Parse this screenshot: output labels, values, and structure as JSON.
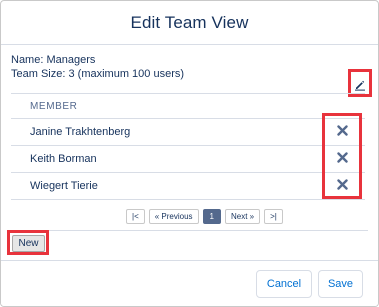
{
  "modal": {
    "title": "Edit Team View"
  },
  "team": {
    "name_label": "Name:",
    "name_value": "Managers",
    "size_label": "Team Size:",
    "size_value": "3 (maximum 100 users)"
  },
  "table": {
    "header": "MEMBER",
    "rows": [
      {
        "name": "Janine Trakhtenberg"
      },
      {
        "name": "Keith Borman"
      },
      {
        "name": "Wiegert Tierie"
      }
    ]
  },
  "pager": {
    "first": "|<",
    "prev": "« Previous",
    "current": "1",
    "next": "Next »",
    "last": ">|"
  },
  "actions": {
    "new_label": "New",
    "cancel_label": "Cancel",
    "save_label": "Save"
  },
  "colors": {
    "highlight": "#e8333c",
    "link": "#0070d2",
    "text": "#16325c",
    "pager_active": "#54698d"
  },
  "icons": {
    "edit": "pencil-icon",
    "remove": "close-x-icon"
  }
}
